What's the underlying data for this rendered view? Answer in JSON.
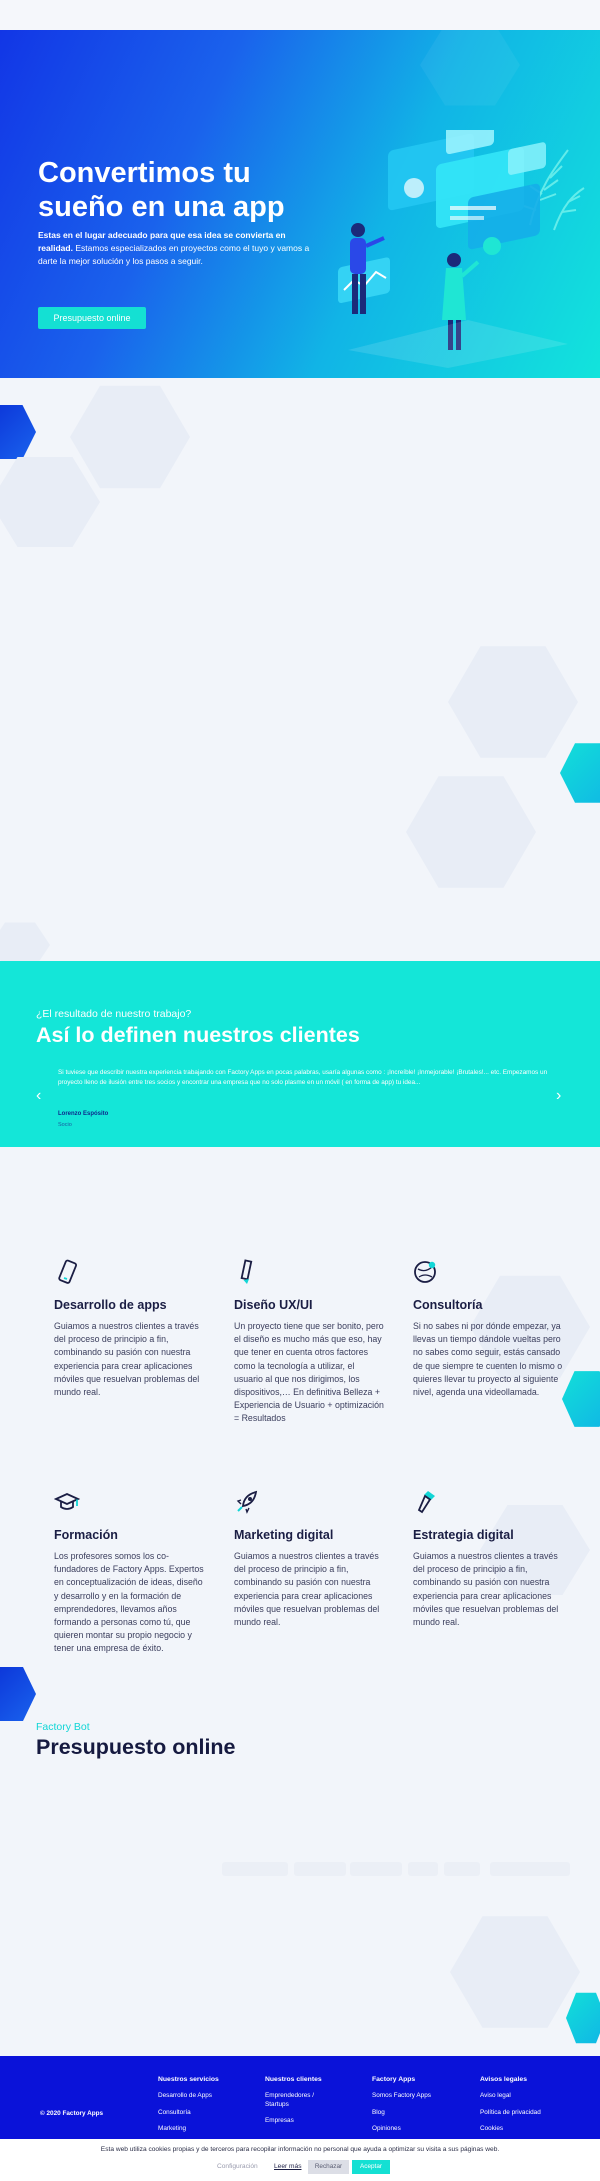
{
  "hero": {
    "title": "Convertimos tu sueño en una app",
    "text_bold": "Estas en el lugar adecuado para que esa idea se convierta en realidad.",
    "text": " Estamos especializados en proyectos como el tuyo y vamos a darte la mejor solución y los pasos a seguir.",
    "button": "Presupuesto online"
  },
  "testimonial": {
    "kicker": "¿El resultado de nuestro trabajo?",
    "title": "Así lo definen nuestros clientes",
    "quote": "Si tuviese que describir nuestra experiencia trabajando con Factory Apps en pocas palabras, usaría algunas como : ¡Increíble! ¡Inmejorable! ¡Brutales!... etc. Empezamos un proyecto lleno de ilusión entre tres socios y encontrar una empresa que no solo plasme en un móvil ( en forma de app) tu idea...",
    "author": "Lorenzo Espósito",
    "role": "Socio",
    "prev_icon": "chevron-left",
    "next_icon": "chevron-right"
  },
  "services": [
    {
      "icon": "phone-icon",
      "title": "Desarrollo de apps",
      "desc": "Guiamos a nuestros clientes a través del proceso de principio a fin, combinando su pasión con nuestra experiencia para crear aplicaciones móviles que resuelvan problemas del mundo real."
    },
    {
      "icon": "pencil-icon",
      "title": "Diseño UX/UI",
      "desc": "Un proyecto tiene que ser bonito, pero el diseño es mucho más que eso, hay que tener en cuenta otros factores como la tecnología a utilizar, el usuario al que nos dirigimos, los dispositivos,… En definitiva Belleza + Experiencia de Usuario + optimización = Resultados"
    },
    {
      "icon": "globe-icon",
      "title": "Consultoría",
      "desc": "Si no sabes ni por dónde empezar, ya llevas un tiempo dándole vueltas pero no sabes como seguir, estás cansado de que siempre te cuenten lo mismo o quieres llevar tu proyecto al siguiente nivel, agenda una videollamada."
    },
    {
      "icon": "graduation-cap-icon",
      "title": "Formación",
      "desc": "Los profesores somos los co-fundadores de Factory Apps. Expertos en conceptualización de ideas, diseño y desarrollo y en la formación de emprendedores, llevamos años formando a personas como tú, que quieren montar su propio negocio y tener una empresa de éxito."
    },
    {
      "icon": "rocket-icon",
      "title": "Marketing digital",
      "desc": "Guiamos a nuestros clientes a través del proceso de principio a fin, combinando su pasión con nuestra experiencia para crear aplicaciones móviles que resuelvan problemas del mundo real."
    },
    {
      "icon": "flashlight-icon",
      "title": "Estrategia digital",
      "desc": "Guiamos a nuestros clientes a través del proceso de principio a fin, combinando su pasión con nuestra experiencia para crear aplicaciones móviles que resuelvan problemas del mundo real."
    }
  ],
  "budget": {
    "kicker": "Factory Bot",
    "title": "Presupuesto online"
  },
  "footer": {
    "copyright": "© 2020 Factory Apps",
    "columns": [
      {
        "heading": "Nuestros servicios",
        "links": [
          "Desarrollo de Apps",
          "Consultoría",
          "Marketing"
        ]
      },
      {
        "heading": "Nuestros clientes",
        "links": [
          "Emprendedores / Startups",
          "Empresas"
        ]
      },
      {
        "heading": "Factory Apps",
        "links": [
          "Somos Factory Apps",
          "Blog",
          "Opiniones"
        ]
      },
      {
        "heading": "Avisos legales",
        "links": [
          "Aviso legal",
          "Política de privacidad",
          "Cookies"
        ]
      }
    ]
  },
  "cookie": {
    "text": "Esta web utiliza cookies propias y de terceros para recopilar información no personal que ayuda a optimizar su visita a sus páginas web.",
    "config": "Configuración",
    "read_more": "Leer más",
    "reject": "Rechazar",
    "accept": "Aceptar"
  },
  "colors": {
    "brand_blue": "#0a12d9",
    "brand_teal": "#14e0d3",
    "hero_gradient": [
      "#1236e6",
      "#12e4dc"
    ],
    "heading": "#1b1e44"
  }
}
